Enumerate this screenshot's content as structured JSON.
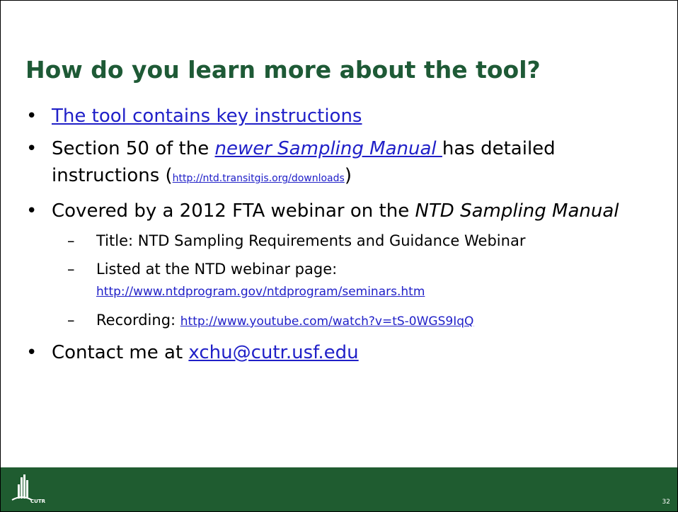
{
  "slide": {
    "title": "How do you learn more about the tool?",
    "bullets": {
      "b1_link": "The tool contains key instructions",
      "b2_prefix": "Section 50 of the ",
      "b2_link": "newer Sampling Manual ",
      "b2_mid": "has detailed instructions (",
      "b2_url": "http://ntd.transitgis.org/downloads",
      "b2_suffix": ")",
      "b3_prefix": "Covered by a 2012 FTA webinar on the ",
      "b3_em": "NTD Sampling Manual",
      "sub1": "Title: NTD Sampling Requirements and Guidance Webinar",
      "sub2_prefix": "Listed at the NTD webinar page:",
      "sub2_url": "http://www.ntdprogram.gov/ntdprogram/seminars.htm",
      "sub3_prefix": "Recording: ",
      "sub3_url": "http://www.youtube.com/watch?v=tS-0WGS9IqQ",
      "b4_prefix": "Contact me at ",
      "b4_email": "xchu@cutr.usf.edu"
    },
    "footer": {
      "logo_text": "CUTR",
      "page_number": "32"
    },
    "colors": {
      "title": "#1e5a36",
      "footer_bg": "#1f5c30",
      "link": "#1a0dab"
    }
  }
}
